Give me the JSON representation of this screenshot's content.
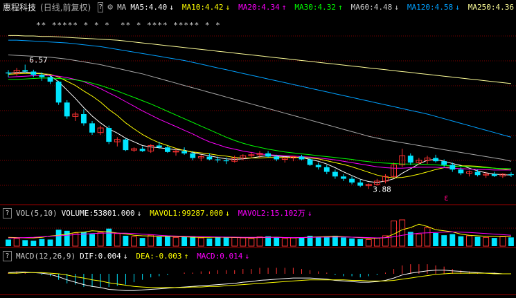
{
  "colors": {
    "bg": "#000000",
    "grid": "#7a0000",
    "up": "#ff3232",
    "down": "#00e5ff",
    "ma5": "#ffffff",
    "ma10": "#ffff00",
    "ma20": "#ff00ff",
    "ma30": "#00ff00",
    "ma60": "#aaaaaa",
    "ma120": "#00a0ff",
    "ma250": "#ffff99",
    "dif": "#ffffff",
    "dea": "#ffff00",
    "macd": "#ff00ff"
  },
  "header": {
    "stock_name": "惠程科技",
    "period": "(日线,前复权)",
    "help": "?",
    "gear_icon": "⚙",
    "ma_label": "MA",
    "ma": [
      {
        "label": "MA5:4.40",
        "arrow": "↓"
      },
      {
        "label": "MA10:4.42",
        "arrow": "↓"
      },
      {
        "label": "MA20:4.34",
        "arrow": "↑"
      },
      {
        "label": "MA30:4.32",
        "arrow": "↑"
      },
      {
        "label": "MA60:4.48",
        "arrow": "↓"
      },
      {
        "label": "MA120:4.58",
        "arrow": "↓"
      },
      {
        "label": "MA250:4.36",
        "arrow": "↑"
      }
    ]
  },
  "volume_header": {
    "help": "?",
    "name": "VOL(5,10)",
    "volume": "VOLUME:53801.000",
    "volume_arrow": "↓",
    "mavol1": "MAVOL1:99287.000",
    "mavol1_arrow": "↓",
    "mavol2": "MAVOL2:15.102万",
    "mavol2_arrow": "↓"
  },
  "macd_header": {
    "help": "?",
    "name": "MACD(12,26,9)",
    "dif": "DIF:0.004",
    "dif_arrow": "↓",
    "dea": "DEA:-0.003",
    "dea_arrow": "↑",
    "macd": "MACD:0.014",
    "macd_arrow": "↓"
  },
  "chart_data": {
    "type": "candlestick",
    "annotations": {
      "high": "6.57",
      "low": "3.88",
      "marker": "ε"
    },
    "event_stars": "** ***** * * *  ** * **** ***** * *",
    "ohlc": [
      [
        6.4,
        6.45,
        6.3,
        6.38
      ],
      [
        6.38,
        6.5,
        6.33,
        6.45
      ],
      [
        6.45,
        6.57,
        6.4,
        6.42
      ],
      [
        6.42,
        6.46,
        6.3,
        6.35
      ],
      [
        6.35,
        6.4,
        6.22,
        6.3
      ],
      [
        6.3,
        6.33,
        6.15,
        6.2
      ],
      [
        6.2,
        6.22,
        5.7,
        5.75
      ],
      [
        5.75,
        5.8,
        5.4,
        5.45
      ],
      [
        5.45,
        5.55,
        5.35,
        5.5
      ],
      [
        5.5,
        5.6,
        5.25,
        5.3
      ],
      [
        5.3,
        5.35,
        5.05,
        5.1
      ],
      [
        5.1,
        5.25,
        5.05,
        5.2
      ],
      [
        5.2,
        5.25,
        4.85,
        4.9
      ],
      [
        4.9,
        5.0,
        4.8,
        4.95
      ],
      [
        4.95,
        4.97,
        4.7,
        4.72
      ],
      [
        4.72,
        4.78,
        4.68,
        4.75
      ],
      [
        4.75,
        4.8,
        4.68,
        4.7
      ],
      [
        4.7,
        4.85,
        4.66,
        4.82
      ],
      [
        4.82,
        4.9,
        4.75,
        4.78
      ],
      [
        4.78,
        4.82,
        4.66,
        4.68
      ],
      [
        4.68,
        4.75,
        4.6,
        4.7
      ],
      [
        4.7,
        4.78,
        4.62,
        4.65
      ],
      [
        4.65,
        4.7,
        4.5,
        4.55
      ],
      [
        4.55,
        4.62,
        4.48,
        4.58
      ],
      [
        4.58,
        4.65,
        4.5,
        4.52
      ],
      [
        4.52,
        4.58,
        4.45,
        4.5
      ],
      [
        4.5,
        4.56,
        4.42,
        4.48
      ],
      [
        4.48,
        4.6,
        4.45,
        4.55
      ],
      [
        4.55,
        4.63,
        4.5,
        4.6
      ],
      [
        4.6,
        4.68,
        4.55,
        4.62
      ],
      [
        4.62,
        4.7,
        4.55,
        4.65
      ],
      [
        4.65,
        4.7,
        4.56,
        4.58
      ],
      [
        4.58,
        4.62,
        4.48,
        4.52
      ],
      [
        4.52,
        4.58,
        4.45,
        4.55
      ],
      [
        4.55,
        4.6,
        4.48,
        4.58
      ],
      [
        4.58,
        4.62,
        4.5,
        4.52
      ],
      [
        4.52,
        4.55,
        4.38,
        4.4
      ],
      [
        4.4,
        4.45,
        4.3,
        4.35
      ],
      [
        4.35,
        4.4,
        4.2,
        4.25
      ],
      [
        4.25,
        4.3,
        4.1,
        4.15
      ],
      [
        4.15,
        4.2,
        4.05,
        4.1
      ],
      [
        4.1,
        4.15,
        3.98,
        4.02
      ],
      [
        4.02,
        4.08,
        3.92,
        3.95
      ],
      [
        3.95,
        4.0,
        3.88,
        3.98
      ],
      [
        3.98,
        4.1,
        3.95,
        4.05
      ],
      [
        4.05,
        4.2,
        4.0,
        4.15
      ],
      [
        4.15,
        4.45,
        4.12,
        4.4
      ],
      [
        4.4,
        4.75,
        4.35,
        4.6
      ],
      [
        4.6,
        4.65,
        4.4,
        4.45
      ],
      [
        4.45,
        4.55,
        4.4,
        4.5
      ],
      [
        4.5,
        4.6,
        4.42,
        4.55
      ],
      [
        4.55,
        4.62,
        4.45,
        4.48
      ],
      [
        4.48,
        4.52,
        4.35,
        4.4
      ],
      [
        4.4,
        4.45,
        4.25,
        4.3
      ],
      [
        4.3,
        4.35,
        4.18,
        4.22
      ],
      [
        4.22,
        4.28,
        4.15,
        4.25
      ],
      [
        4.25,
        4.3,
        4.15,
        4.18
      ],
      [
        4.18,
        4.25,
        4.12,
        4.2
      ],
      [
        4.2,
        4.25,
        4.14,
        4.16
      ],
      [
        4.16,
        4.22,
        4.12,
        4.2
      ],
      [
        4.2,
        4.24,
        4.14,
        4.18
      ]
    ],
    "ma_lines": {
      "ma5": [
        6.38,
        6.4,
        6.41,
        6.39,
        6.38,
        6.33,
        6.2,
        6.02,
        5.84,
        5.64,
        5.46,
        5.31,
        5.18,
        5.09,
        4.98,
        4.9,
        4.82,
        4.79,
        4.77,
        4.75,
        4.73,
        4.72,
        4.67,
        4.63,
        4.6,
        4.56,
        4.53,
        4.52,
        4.53,
        4.55,
        4.58,
        4.6,
        4.59,
        4.58,
        4.57,
        4.56,
        4.52,
        4.48,
        4.42,
        4.34,
        4.25,
        4.17,
        4.09,
        4.04,
        4.02,
        4.05,
        4.1,
        4.22,
        4.32,
        4.42,
        4.5,
        4.52,
        4.48,
        4.43,
        4.39,
        4.33,
        4.27,
        4.23,
        4.2,
        4.19,
        4.18
      ],
      "ma10": [
        6.36,
        6.37,
        6.38,
        6.38,
        6.37,
        6.36,
        6.3,
        6.21,
        6.12,
        6.0,
        5.89,
        5.76,
        5.6,
        5.47,
        5.31,
        5.18,
        5.06,
        4.96,
        4.88,
        4.82,
        4.76,
        4.71,
        4.68,
        4.66,
        4.64,
        4.61,
        4.59,
        4.56,
        4.55,
        4.55,
        4.55,
        4.56,
        4.56,
        4.56,
        4.56,
        4.56,
        4.55,
        4.53,
        4.49,
        4.45,
        4.41,
        4.36,
        4.3,
        4.24,
        4.18,
        4.14,
        4.12,
        4.13,
        4.16,
        4.2,
        4.25,
        4.3,
        4.34,
        4.36,
        4.38,
        4.38,
        4.37,
        4.35,
        4.33,
        4.31,
        4.29
      ],
      "ma20": [
        6.3,
        6.31,
        6.32,
        6.33,
        6.34,
        6.34,
        6.32,
        6.29,
        6.25,
        6.2,
        6.13,
        6.05,
        5.96,
        5.87,
        5.77,
        5.67,
        5.57,
        5.48,
        5.39,
        5.31,
        5.23,
        5.15,
        5.07,
        4.98,
        4.9,
        4.84,
        4.78,
        4.74,
        4.7,
        4.67,
        4.64,
        4.62,
        4.61,
        4.6,
        4.59,
        4.58,
        4.57,
        4.55,
        4.53,
        4.51,
        4.48,
        4.45,
        4.42,
        4.39,
        4.36,
        4.34,
        4.33,
        4.33,
        4.34,
        4.35,
        4.35,
        4.35,
        4.34,
        4.33,
        4.32,
        4.31,
        4.3,
        4.3,
        4.29,
        4.29,
        4.29
      ],
      "ma30": [
        6.25,
        6.25,
        6.26,
        6.27,
        6.28,
        6.28,
        6.27,
        6.26,
        6.24,
        6.21,
        6.17,
        6.12,
        6.06,
        6.0,
        5.93,
        5.86,
        5.79,
        5.72,
        5.64,
        5.56,
        5.48,
        5.4,
        5.32,
        5.24,
        5.16,
        5.08,
        5.0,
        4.93,
        4.87,
        4.82,
        4.78,
        4.74,
        4.71,
        4.68,
        4.66,
        4.64,
        4.62,
        4.6,
        4.58,
        4.56,
        4.54,
        4.52,
        4.49,
        4.47,
        4.45,
        4.44,
        4.43,
        4.42,
        4.42,
        4.42,
        4.41,
        4.4,
        4.39,
        4.38,
        4.37,
        4.36,
        4.35,
        4.34,
        4.33,
        4.32,
        4.32
      ],
      "ma60": [
        6.78,
        6.77,
        6.76,
        6.75,
        6.74,
        6.73,
        6.71,
        6.69,
        6.66,
        6.63,
        6.6,
        6.57,
        6.53,
        6.49,
        6.45,
        6.41,
        6.37,
        6.32,
        6.27,
        6.22,
        6.17,
        6.12,
        6.07,
        6.02,
        5.97,
        5.92,
        5.87,
        5.82,
        5.77,
        5.72,
        5.67,
        5.62,
        5.57,
        5.52,
        5.47,
        5.42,
        5.37,
        5.32,
        5.27,
        5.22,
        5.17,
        5.12,
        5.07,
        5.02,
        4.98,
        4.94,
        4.91,
        4.88,
        4.85,
        4.82,
        4.79,
        4.76,
        4.73,
        4.7,
        4.67,
        4.64,
        4.61,
        4.58,
        4.55,
        4.52,
        4.48
      ],
      "ma120": [
        7.1,
        7.1,
        7.09,
        7.08,
        7.07,
        7.06,
        7.05,
        7.04,
        7.02,
        7.0,
        6.98,
        6.96,
        6.93,
        6.9,
        6.87,
        6.84,
        6.81,
        6.78,
        6.75,
        6.72,
        6.69,
        6.66,
        6.62,
        6.58,
        6.54,
        6.5,
        6.46,
        6.42,
        6.38,
        6.34,
        6.3,
        6.26,
        6.22,
        6.18,
        6.14,
        6.1,
        6.06,
        6.02,
        5.98,
        5.94,
        5.9,
        5.86,
        5.82,
        5.78,
        5.74,
        5.7,
        5.66,
        5.62,
        5.58,
        5.54,
        5.5,
        5.45,
        5.4,
        5.35,
        5.3,
        5.25,
        5.2,
        5.15,
        5.1,
        5.05,
        5.0
      ],
      "ma250": [
        7.2,
        7.2,
        7.19,
        7.19,
        7.18,
        7.18,
        7.17,
        7.16,
        7.15,
        7.14,
        7.13,
        7.12,
        7.11,
        7.1,
        7.08,
        7.06,
        7.04,
        7.02,
        7.0,
        6.98,
        6.96,
        6.94,
        6.92,
        6.9,
        6.88,
        6.86,
        6.84,
        6.82,
        6.8,
        6.78,
        6.76,
        6.74,
        6.72,
        6.7,
        6.68,
        6.66,
        6.64,
        6.62,
        6.6,
        6.58,
        6.56,
        6.54,
        6.52,
        6.5,
        6.48,
        6.46,
        6.44,
        6.42,
        6.4,
        6.38,
        6.36,
        6.34,
        6.32,
        6.3,
        6.28,
        6.26,
        6.24,
        6.22,
        6.2,
        6.18,
        6.16
      ]
    },
    "volume": [
      60,
      70,
      55,
      50,
      65,
      60,
      150,
      140,
      120,
      130,
      110,
      125,
      160,
      115,
      95,
      85,
      75,
      100,
      90,
      95,
      80,
      85,
      90,
      75,
      70,
      80,
      85,
      80,
      75,
      70,
      85,
      90,
      80,
      70,
      75,
      80,
      95,
      85,
      90,
      95,
      80,
      70,
      65,
      60,
      75,
      95,
      230,
      240,
      130,
      110,
      170,
      120,
      100,
      110,
      90,
      95,
      85,
      80,
      75,
      90,
      80
    ],
    "vol_ma": {
      "mavol1": [
        80,
        78,
        76,
        75,
        80,
        92,
        100,
        110,
        125,
        128,
        140,
        135,
        130,
        120,
        112,
        100,
        95,
        92,
        88,
        90,
        88,
        85,
        82,
        80,
        80,
        82,
        80,
        79,
        78,
        76,
        78,
        80,
        82,
        78,
        76,
        78,
        82,
        85,
        88,
        90,
        86,
        82,
        78,
        72,
        72,
        78,
        110,
        150,
        170,
        200,
        180,
        150,
        140,
        130,
        110,
        100,
        95,
        90,
        88,
        85,
        87
      ],
      "mavol2": [
        75,
        76,
        78,
        80,
        85,
        90,
        95,
        100,
        105,
        110,
        115,
        118,
        120,
        119,
        118,
        115,
        110,
        106,
        100,
        95,
        92,
        90,
        88,
        86,
        85,
        84,
        83,
        82,
        81,
        80,
        80,
        80,
        80,
        79,
        78,
        79,
        80,
        82,
        83,
        84,
        84,
        82,
        80,
        78,
        76,
        77,
        85,
        100,
        110,
        118,
        122,
        125,
        128,
        130,
        128,
        125,
        120,
        115,
        110,
        105,
        100
      ]
    },
    "macd": {
      "dif": [
        0.02,
        0.03,
        0.03,
        0.02,
        0.01,
        -0.01,
        -0.05,
        -0.1,
        -0.14,
        -0.18,
        -0.21,
        -0.23,
        -0.26,
        -0.27,
        -0.28,
        -0.28,
        -0.27,
        -0.26,
        -0.25,
        -0.24,
        -0.23,
        -0.22,
        -0.21,
        -0.2,
        -0.19,
        -0.18,
        -0.17,
        -0.16,
        -0.14,
        -0.13,
        -0.11,
        -0.1,
        -0.09,
        -0.08,
        -0.07,
        -0.07,
        -0.07,
        -0.08,
        -0.09,
        -0.11,
        -0.12,
        -0.13,
        -0.14,
        -0.14,
        -0.13,
        -0.11,
        -0.07,
        -0.02,
        0.01,
        0.03,
        0.05,
        0.06,
        0.06,
        0.05,
        0.04,
        0.03,
        0.02,
        0.01,
        0.01,
        0.0,
        0.0
      ],
      "dea": [
        0.01,
        0.01,
        0.02,
        0.02,
        0.02,
        0.01,
        0.0,
        -0.02,
        -0.05,
        -0.07,
        -0.1,
        -0.12,
        -0.15,
        -0.17,
        -0.19,
        -0.21,
        -0.22,
        -0.23,
        -0.23,
        -0.23,
        -0.23,
        -0.23,
        -0.22,
        -0.22,
        -0.21,
        -0.21,
        -0.2,
        -0.19,
        -0.18,
        -0.17,
        -0.16,
        -0.15,
        -0.14,
        -0.13,
        -0.12,
        -0.11,
        -0.1,
        -0.1,
        -0.1,
        -0.1,
        -0.1,
        -0.11,
        -0.11,
        -0.12,
        -0.12,
        -0.12,
        -0.11,
        -0.09,
        -0.07,
        -0.05,
        -0.03,
        -0.01,
        0.0,
        0.01,
        0.01,
        0.01,
        0.01,
        0.01,
        0.0,
        0.0,
        -0.0
      ]
    }
  }
}
